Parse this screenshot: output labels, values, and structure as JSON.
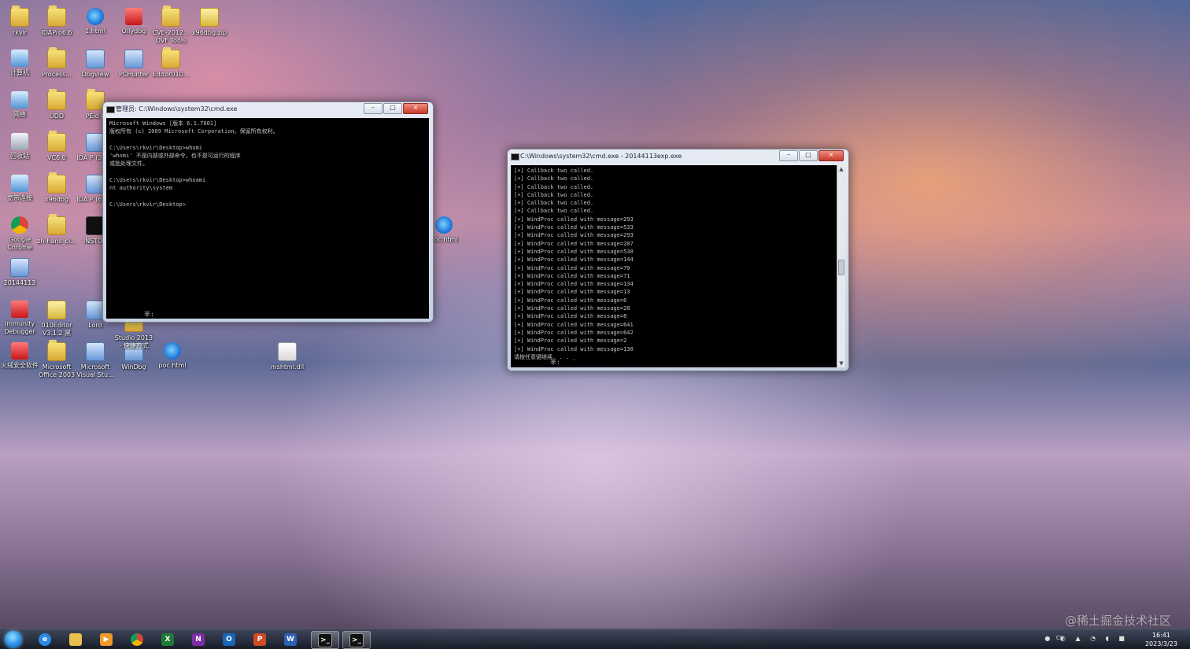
{
  "desktop": {
    "icons": [
      {
        "label": "rkvir",
        "type": "folder"
      },
      {
        "label": "IDAPro6.6",
        "type": "folder"
      },
      {
        "label": "1.html",
        "type": "ie"
      },
      {
        "label": "Ollydbg",
        "type": "red"
      },
      {
        "label": "CVE-2012... OVF Tools",
        "type": "folder"
      },
      {
        "label": "x96dbg.zip",
        "type": "zip"
      },
      {
        "label": "计算机",
        "type": "pc"
      },
      {
        "label": "Process...",
        "type": "folder"
      },
      {
        "label": "Dbgview",
        "type": "app"
      },
      {
        "label": "PCHunter",
        "type": "app"
      },
      {
        "label": "Editor010...",
        "type": "folder"
      },
      {
        "label": "网络",
        "type": "pc"
      },
      {
        "label": "UDD",
        "type": "folder"
      },
      {
        "label": "PEid 0",
        "type": "folder"
      },
      {
        "label": "回收站",
        "type": "trash"
      },
      {
        "label": "VC6.0",
        "type": "folder"
      },
      {
        "label": "IDA P (32 bi",
        "type": "app"
      },
      {
        "label": "宽带连接",
        "type": "pc"
      },
      {
        "label": "x96dbg",
        "type": "folder"
      },
      {
        "label": "IDA P (64 bi",
        "type": "app"
      },
      {
        "label": "Google Chrome",
        "type": "chrome"
      },
      {
        "label": "zh-hans_ci...",
        "type": "folder"
      },
      {
        "label": "INSTOR",
        "type": "dark"
      },
      {
        "label": "20144113",
        "type": "app"
      },
      {
        "label": "Immunity Debugger",
        "type": "red"
      },
      {
        "label": "010Editor V3.1.2 黑蓝...",
        "type": "zip"
      },
      {
        "label": "Lord",
        "type": "app"
      },
      {
        "label": "火绒安全软件",
        "type": "red"
      },
      {
        "label": "Microsoft Office 2003",
        "type": "folder"
      },
      {
        "label": "Microsoft Visual Stu...",
        "type": "app"
      },
      {
        "label": "WinDbg",
        "type": "app"
      },
      {
        "label": "poc.html",
        "type": "ie"
      },
      {
        "label": "mshtml.dll",
        "type": "file"
      },
      {
        "label": "poc.html",
        "type": "ie"
      },
      {
        "label": "Studio 2013 - 快捷方式",
        "type": "folder"
      }
    ]
  },
  "windows": {
    "cmd1": {
      "title": "管理员: C:\\Windows\\system32\\cmd.exe",
      "lines": [
        "Microsoft Windows [版本 6.1.7601]",
        "版权所有 (c) 2009 Microsoft Corporation。保留所有权利。",
        "",
        "C:\\Users\\rkvir\\Desktop>whomi",
        "'whomi' 不是内部或外部命令，也不是可运行的程序",
        "或批处理文件。",
        "",
        "C:\\Users\\rkvir\\Desktop>whoami",
        "nt authority\\system",
        "",
        "C:\\Users\\rkvir\\Desktop>"
      ],
      "ime": "半:"
    },
    "cmd2": {
      "title": "C:\\Windows\\system32\\cmd.exe - 20144113exp.exe",
      "lines": [
        "[+] Callback two called.",
        "[+] Callback two called.",
        "[+] Callback two called.",
        "[+] Callback two called.",
        "[+] Callback two called.",
        "[+] Callback two called.",
        "[+] WindProc called with message=293",
        "[+] WindProc called with message=533",
        "[+] WindProc called with message=293",
        "[+] WindProc called with message=287",
        "[+] WindProc called with message=530",
        "[+] WindProc called with message=144",
        "[+] WindProc called with message=70",
        "[+] WindProc called with message=71",
        "[+] WindProc called with message=134",
        "[+] WindProc called with message=13",
        "[+] WindProc called with message=6",
        "[+] WindProc called with message=28",
        "[+] WindProc called with message=8",
        "[+] WindProc called with message=641",
        "[+] WindProc called with message=642",
        "[+] WindProc called with message=2",
        "[+] WindProc called with message=130",
        "请按任意键继续. . . _"
      ],
      "ime": "半:"
    }
  },
  "taskbar": {
    "tray_label": "CH",
    "time": "16:41",
    "date": "2023/3/23"
  },
  "watermark": "@稀土掘金技术社区"
}
